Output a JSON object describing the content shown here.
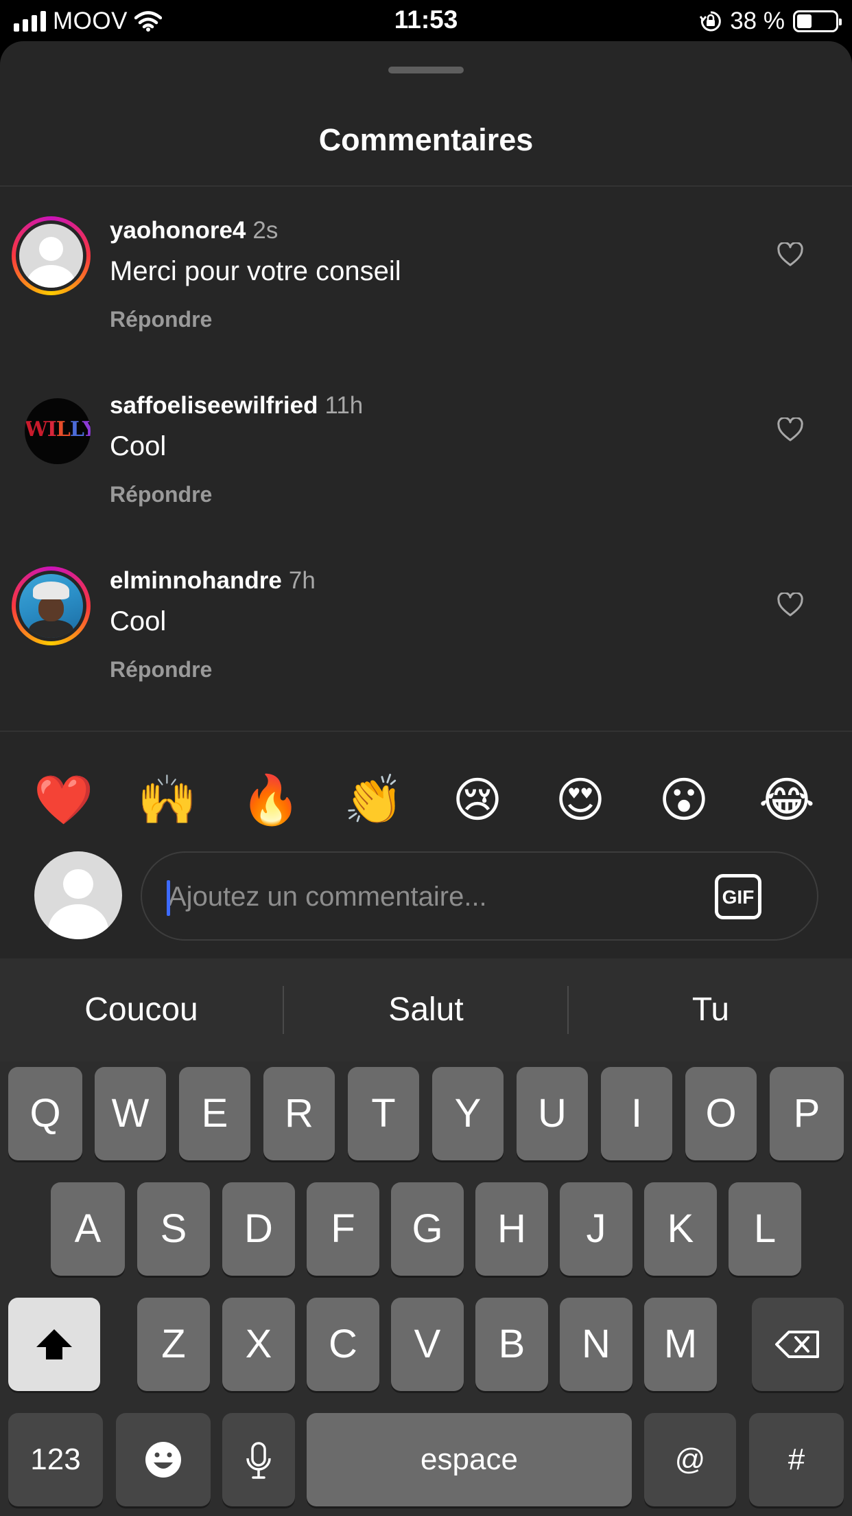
{
  "status_bar": {
    "carrier": "MOOV",
    "time": "11:53",
    "battery_percent": "38 %",
    "battery_level": 0.38
  },
  "sheet": {
    "title": "Commentaires"
  },
  "comments": [
    {
      "username": "yaohonore4",
      "time": "2s",
      "text": "Merci pour votre conseil",
      "reply_label": "Répondre"
    },
    {
      "username": "saffoeliseewilfried",
      "time": "11h",
      "text": "Cool",
      "reply_label": "Répondre",
      "avatar_text": "WILLY"
    },
    {
      "username": "elminnohandre",
      "time": "7h",
      "text": "Cool",
      "reply_label": "Répondre"
    }
  ],
  "emoji_bar": [
    "❤️",
    "🙌",
    "🔥",
    "👏",
    "😢",
    "😍",
    "😮",
    "😂"
  ],
  "comment_input": {
    "placeholder": "Ajoutez un commentaire...",
    "gif_label": "GIF"
  },
  "keyboard": {
    "suggestions": [
      "Coucou",
      "Salut",
      "Tu"
    ],
    "row1": [
      "Q",
      "W",
      "E",
      "R",
      "T",
      "Y",
      "U",
      "I",
      "O",
      "P"
    ],
    "row2": [
      "A",
      "S",
      "D",
      "F",
      "G",
      "H",
      "J",
      "K",
      "L"
    ],
    "row3": [
      "Z",
      "X",
      "C",
      "V",
      "B",
      "N",
      "M"
    ],
    "numbers_label": "123",
    "space_label": "espace",
    "at_label": "@",
    "hash_label": "#"
  },
  "icons": {
    "heart": "heart-outline-icon",
    "shift": "shift-arrow-icon",
    "delete": "backspace-icon",
    "emoji": "smiley-icon",
    "mic": "microphone-icon"
  }
}
